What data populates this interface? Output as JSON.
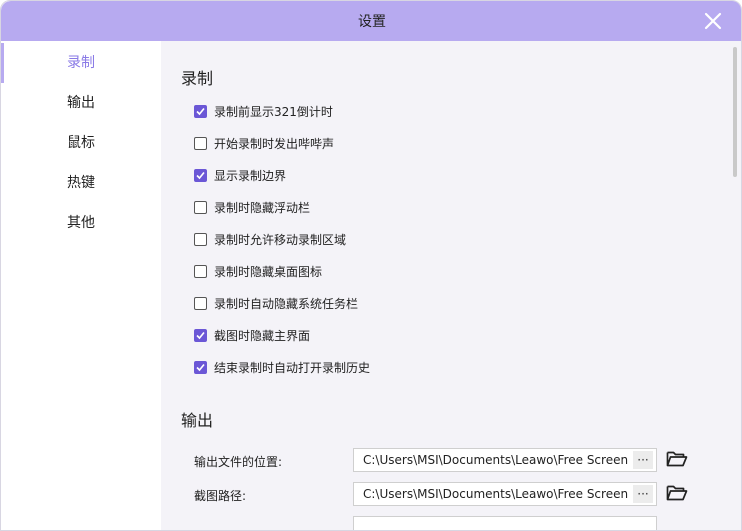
{
  "window": {
    "title": "设置"
  },
  "sidebar": {
    "items": [
      {
        "label": "录制",
        "active": true
      },
      {
        "label": "输出",
        "active": false
      },
      {
        "label": "鼠标",
        "active": false
      },
      {
        "label": "热键",
        "active": false
      },
      {
        "label": "其他",
        "active": false
      }
    ]
  },
  "record_section": {
    "title": "录制",
    "options": [
      {
        "label": "录制前显示321倒计时",
        "checked": true
      },
      {
        "label": "开始录制时发出哔哔声",
        "checked": false
      },
      {
        "label": "显示录制边界",
        "checked": true
      },
      {
        "label": "录制时隐藏浮动栏",
        "checked": false
      },
      {
        "label": "录制时允许移动录制区域",
        "checked": false
      },
      {
        "label": "录制时隐藏桌面图标",
        "checked": false
      },
      {
        "label": "录制时自动隐藏系统任务栏",
        "checked": false
      },
      {
        "label": "截图时隐藏主界面",
        "checked": true
      },
      {
        "label": "结束录制时自动打开录制历史",
        "checked": true
      }
    ]
  },
  "output_section": {
    "title": "输出",
    "fields": [
      {
        "label": "输出文件的位置:",
        "value": "C:\\Users\\MSI\\Documents\\Leawo\\Free Screen",
        "button": "···"
      },
      {
        "label": "截图路径:",
        "value": "C:\\Users\\MSI\\Documents\\Leawo\\Free Screen",
        "button": "···"
      }
    ]
  },
  "colors": {
    "accent": "#b7aaf0",
    "checkbox": "#6b57d6",
    "active_text": "#8a7ae6"
  }
}
